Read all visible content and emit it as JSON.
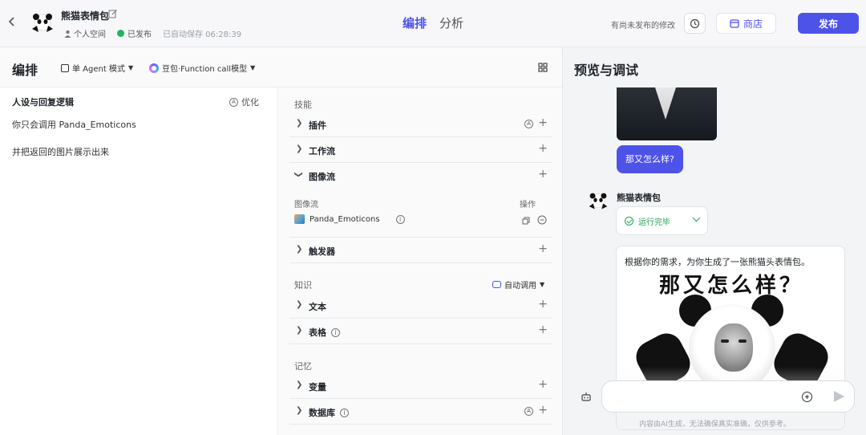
{
  "header": {
    "bot_name": "熊猫表情包",
    "space": "个人空间",
    "status": "已发布",
    "autosave": "已自动保存 06:28:39",
    "tabs": [
      "编排",
      "分析"
    ],
    "unpublished_note": "有尚未发布的修改",
    "store_label": "商店",
    "publish_label": "发布"
  },
  "editor": {
    "title": "编排",
    "mode": "单 Agent 模式",
    "model": "豆包·Function call模型",
    "persona_title": "人设与回复逻辑",
    "optimize_label": "优化",
    "persona_lines": [
      "你只会调用 Panda_Emoticons",
      "并把返回的图片展示出来"
    ]
  },
  "skills": {
    "section_label": "技能",
    "plugin": "插件",
    "workflow": "工作流",
    "imageflow": "图像流",
    "imageflow_col": "图像流",
    "imageflow_op": "操作",
    "imageflow_item": "Panda_Emoticons",
    "trigger": "触发器"
  },
  "knowledge": {
    "section_label": "知识",
    "auto_call": "自动调用",
    "text": "文本",
    "table": "表格"
  },
  "memory": {
    "section_label": "记忆",
    "variable": "变量",
    "database": "数据库"
  },
  "preview": {
    "title": "预览与调试",
    "user_message": "那又怎么样?",
    "bot_name": "熊猫表情包",
    "run_status": "运行完毕",
    "reply_text": "根据你的需求，为你生成了一张熊猫头表情包。",
    "meme_caption": "那又怎么样？",
    "input_placeholder": "",
    "disclaimer": "内容由AI生成，无法确保真实准确，仅供参考。"
  },
  "colors": {
    "accent": "#4d53e8",
    "success": "#21a452"
  }
}
